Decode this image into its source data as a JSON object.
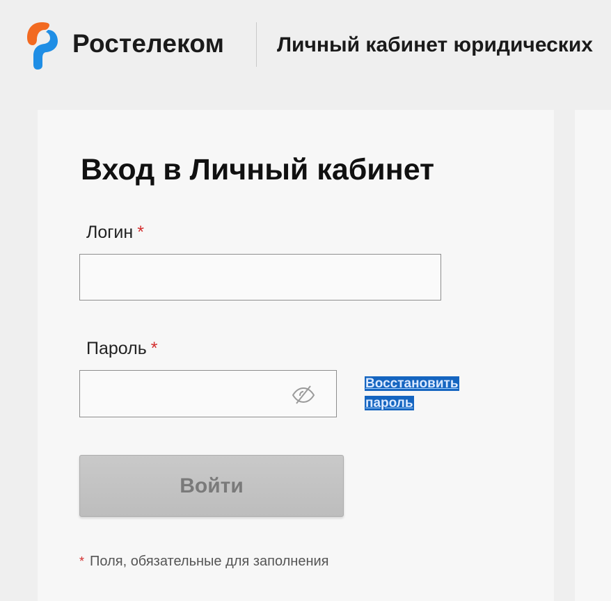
{
  "header": {
    "brand_name": "Ростелеком",
    "portal_title": "Личный кабинет юридических",
    "logo_icon": "rostelecom-logo-icon",
    "brand_colors": {
      "orange": "#f26a21",
      "blue": "#1f8ee5"
    }
  },
  "form": {
    "title": "Вход в Личный кабинет",
    "login_label": "Логин",
    "login_value": "",
    "password_label": "Пароль",
    "password_value": "",
    "required_mark": "*",
    "eye_icon": "eye-crossed-icon",
    "restore_line1": "Восстановить",
    "restore_line2": "пароль",
    "submit_label": "Войти",
    "required_note": "Поля, обязательные для заполнения",
    "required_color": "#d32f2f"
  }
}
